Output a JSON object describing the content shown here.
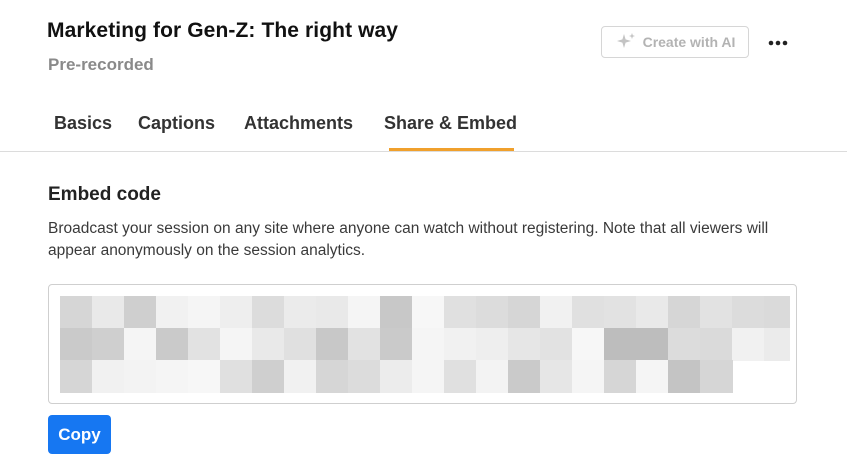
{
  "header": {
    "title": "Marketing for Gen-Z: The right way",
    "subtitle": "Pre-recorded",
    "ai_button_label": "Create with AI",
    "ai_icon": "sparkle-icon",
    "more_icon": "more-horizontal-icon"
  },
  "tabs": [
    {
      "label": "Basics",
      "active": false
    },
    {
      "label": "Captions",
      "active": false
    },
    {
      "label": "Attachments",
      "active": false
    },
    {
      "label": "Share & Embed",
      "active": true
    }
  ],
  "embed": {
    "title": "Embed code",
    "description": "Broadcast your session on any site where anyone can watch without registering. Note that all viewers will appear anonymously on the session analytics.",
    "code_state": "pixelated",
    "copy_label": "Copy"
  },
  "colors": {
    "accent_tab": "#f0a02c",
    "primary_button": "#1677f2",
    "muted_text": "#8a8a8a"
  }
}
